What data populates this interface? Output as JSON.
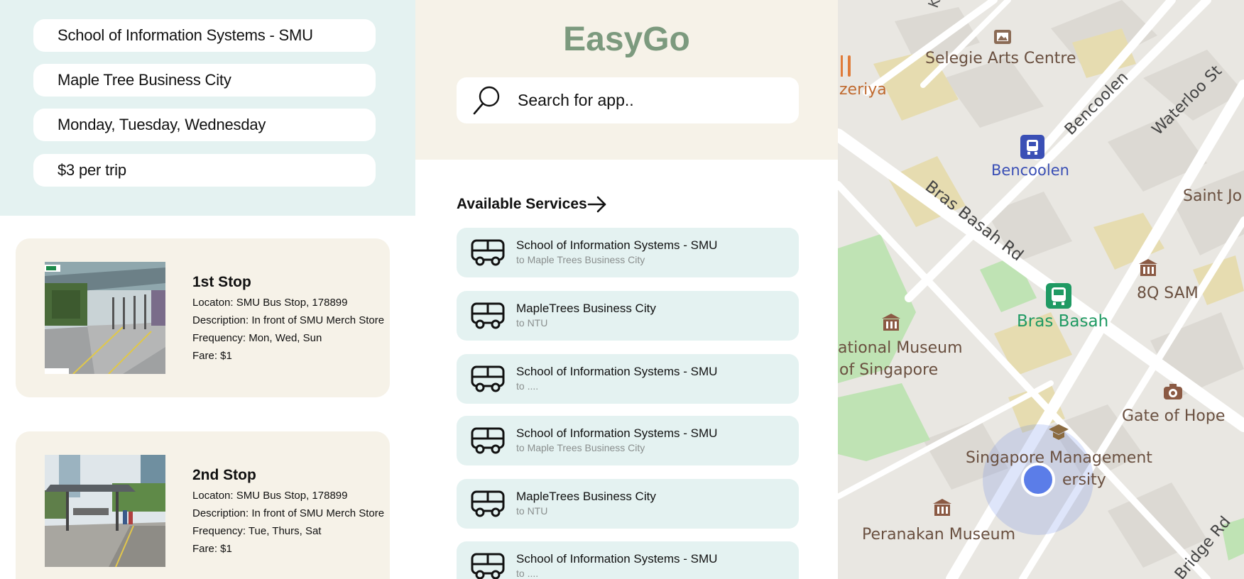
{
  "summary": {
    "origin": "School of Information Systems - SMU",
    "destination": "Maple Tree Business City",
    "days": "Monday, Tuesday, Wednesday",
    "price": "$3 per trip"
  },
  "stops": [
    {
      "title": "1st Stop",
      "location": "Locaton: SMU Bus Stop, 178899",
      "description": "Description: In front of SMU Merch Store",
      "frequency": "Frequency:  Mon, Wed, Sun",
      "fare": "Fare: $1"
    },
    {
      "title": "2nd Stop",
      "location": "Locaton: SMU Bus Stop, 178899",
      "description": "Description: In front of SMU Merch Store",
      "frequency": "Frequency: Tue, Thurs, Sat",
      "fare": "Fare: $1"
    }
  ],
  "app": {
    "title": "EasyGo",
    "search_placeholder": "Search for app..",
    "available_label": "Available Services"
  },
  "services": [
    {
      "name": "School of Information Systems - SMU",
      "dest": "to Maple Trees Business City"
    },
    {
      "name": "MapleTrees Business City",
      "dest": "to NTU"
    },
    {
      "name": "School of Information Systems - SMU",
      "dest": "to ...."
    },
    {
      "name": "School of Information Systems - SMU",
      "dest": "to Maple Trees Business City"
    },
    {
      "name": "MapleTrees Business City",
      "dest": "to NTU"
    },
    {
      "name": "School of Information Systems - SMU",
      "dest": "to ...."
    }
  ],
  "map": {
    "labels": {
      "kirk": "Kirk",
      "selegie": "Selegie Arts Centre",
      "zeriya": "zeriya",
      "bencoolen_st": "Bencoolen",
      "waterloo": "Waterloo St",
      "bencoolen_stn": "Bencoolen",
      "bras_basah_rd": "Bras Basah Rd",
      "saint": "Saint Jo",
      "sam": "8Q SAM",
      "museum_line1": "ational Museum",
      "museum_line2": "of Singapore",
      "bras_basah_stn": "Bras Basah",
      "gate_of_hope": "Gate of Hope",
      "smu_line1": "Singapore Management",
      "smu_line2": "ersity",
      "peranakan": "Peranakan Museum",
      "bridge_rd": "Bridge Rd"
    },
    "colors": {
      "accent_blue": "#3a4fb5",
      "station_green": "#1f9a63",
      "location_dot": "#5b7de8",
      "park_green": "#bfe3b4",
      "block_yellow": "#e6dcb0"
    }
  },
  "colors": {
    "summary_bg": "#e4f2f1",
    "card_bg": "#f6f2e8",
    "brand_green": "#7c9a7e"
  }
}
